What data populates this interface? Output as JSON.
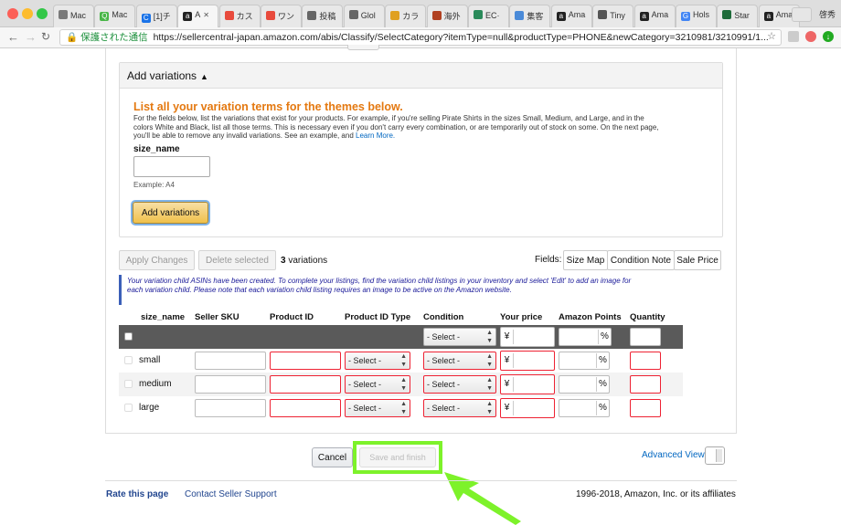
{
  "browser": {
    "tabs": [
      {
        "label": "Mac",
        "color": "#7a7a7a",
        "glyph": ""
      },
      {
        "label": "Mac",
        "color": "#49b648",
        "glyph": "Q"
      },
      {
        "label": "[1]チ",
        "color": "#1a73e8",
        "glyph": "C"
      },
      {
        "label": "A",
        "color": "#222222",
        "glyph": "a"
      },
      {
        "label": "カス",
        "color": "#e84a3c",
        "glyph": ""
      },
      {
        "label": "ワン",
        "color": "#e84a3c",
        "glyph": ""
      },
      {
        "label": "投稿",
        "color": "#666666",
        "glyph": ""
      },
      {
        "label": "Glol",
        "color": "#666666",
        "glyph": ""
      },
      {
        "label": "カラ",
        "color": "#e0a020",
        "glyph": ""
      },
      {
        "label": "海外",
        "color": "#b04020",
        "glyph": ""
      },
      {
        "label": "EC·",
        "color": "#2a8a5a",
        "glyph": ""
      },
      {
        "label": "集客",
        "color": "#4a8ad8",
        "glyph": ""
      },
      {
        "label": "Ama",
        "color": "#222222",
        "glyph": "a"
      },
      {
        "label": "Tiny",
        "color": "#555555",
        "glyph": ""
      },
      {
        "label": "Ama",
        "color": "#222222",
        "glyph": "a"
      },
      {
        "label": "Hols",
        "color": "#4285f4",
        "glyph": "G"
      },
      {
        "label": "Star",
        "color": "#1e6b3a",
        "glyph": ""
      },
      {
        "label": "Ama",
        "color": "#222222",
        "glyph": "a"
      }
    ],
    "profile": "啓秀",
    "secure_label": "保護された通信",
    "url": "https://sellercentral-japan.amazon.com/abis/Classify/SelectCategory?itemType=null&productType=PHONE&newCategory=3210981/3210991/1..."
  },
  "variations": {
    "header": "Add variations",
    "title": "List all your variation terms for the themes below.",
    "description": "For the fields below, list the variations that exist for your products. For example, if you're selling Pirate Shirts in the sizes Small, Medium, and Large, and in the colors White and Black, list all those terms. This is necessary even if you don't carry every combination, or are temporarily out of stock on some. On the next page, you'll be able to remove any invalid variations. See an example, and",
    "learn_more": "Learn More.",
    "field_label": "size_name",
    "example": "Example:  A4",
    "add_button": "Add variations"
  },
  "toolbar": {
    "apply": "Apply Changes",
    "delete": "Delete selected",
    "count": "3",
    "count_suffix": " variations",
    "fields_label": "Fields:",
    "size_map": "Size Map",
    "condition_note": "Condition Note",
    "sale_price": "Sale Price"
  },
  "notice": "Your variation child ASINs have been created. To complete your listings, find the variation child listings in your inventory and select 'Edit' to add an image for each variation child. Please note that each variation child listing requires an image to be active on the Amazon website.",
  "table": {
    "headers": [
      "size_name",
      "Seller SKU",
      "Product ID",
      "Product ID Type",
      "Condition",
      "Your price",
      "Amazon Points",
      "Quantity"
    ],
    "select_placeholder": "- Select -",
    "yen": "¥",
    "percent": "%",
    "rows": [
      {
        "name": "small"
      },
      {
        "name": "medium"
      },
      {
        "name": "large"
      }
    ]
  },
  "footer": {
    "cancel": "Cancel",
    "save": "Save and finish",
    "advanced_view": "Advanced View",
    "rate": "Rate this page",
    "contact": "Contact Seller Support",
    "copyright": "1996-2018, Amazon, Inc. or its affiliates"
  }
}
